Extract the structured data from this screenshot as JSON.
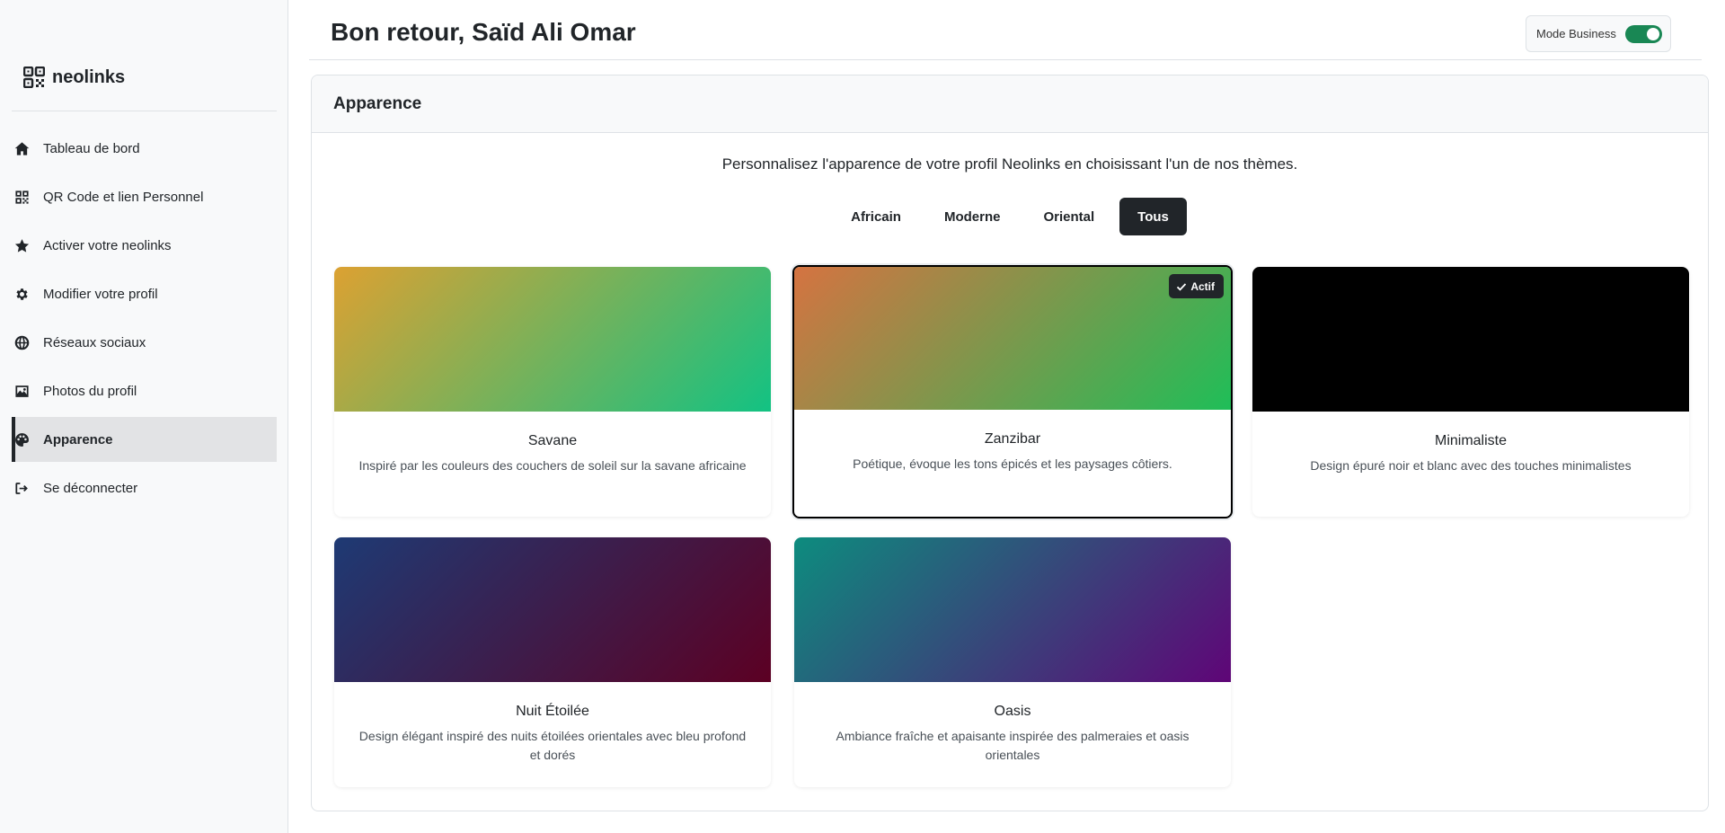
{
  "sidebar": {
    "brand": "neolinks",
    "items": [
      {
        "label": "Tableau de bord",
        "icon": "home-icon"
      },
      {
        "label": "QR Code et lien Personnel",
        "icon": "qrcode-icon"
      },
      {
        "label": "Activer votre neolinks",
        "icon": "star-icon"
      },
      {
        "label": "Modifier votre profil",
        "icon": "gear-icon"
      },
      {
        "label": "Réseaux sociaux",
        "icon": "globe-icon"
      },
      {
        "label": "Photos du profil",
        "icon": "image-icon"
      },
      {
        "label": "Apparence",
        "icon": "palette-icon",
        "active": true
      },
      {
        "label": "Se déconnecter",
        "icon": "logout-icon"
      }
    ]
  },
  "header": {
    "title": "Bon retour, Saïd Ali Omar",
    "mode_label": "Mode Business",
    "mode_on": true
  },
  "appearance": {
    "title": "Apparence",
    "intro": "Personnalisez l'apparence de votre profil Neolinks en choisissant l'un de nos thèmes.",
    "filters": [
      "Africain",
      "Moderne",
      "Oriental",
      "Tous"
    ],
    "active_filter": "Tous",
    "active_badge": "Actif",
    "themes": [
      {
        "name": "Savane",
        "description": "Inspiré par les couleurs des couchers de soleil sur la savane africaine",
        "colors": [
          "#dca132",
          "#12c283"
        ]
      },
      {
        "name": "Zanzibar",
        "description": "Poétique, évoque les tons épicés et les paysages côtiers.",
        "colors": [
          "#d57341",
          "#1fbe58"
        ],
        "selected": true
      },
      {
        "name": "Minimaliste",
        "description": "Design épuré noir et blanc avec des touches minimalistes",
        "colors": [
          "#000000",
          "#000000"
        ]
      },
      {
        "name": "Nuit Étoilée",
        "description": "Design élégant inspiré des nuits étoilées orientales avec bleu profond et dorés",
        "colors": [
          "#1e3a74",
          "#5c0023"
        ]
      },
      {
        "name": "Oasis",
        "description": "Ambiance fraîche et apaisante inspirée des palmeraies et oasis orientales",
        "colors": [
          "#0d8c7e",
          "#5f0577"
        ]
      }
    ]
  }
}
